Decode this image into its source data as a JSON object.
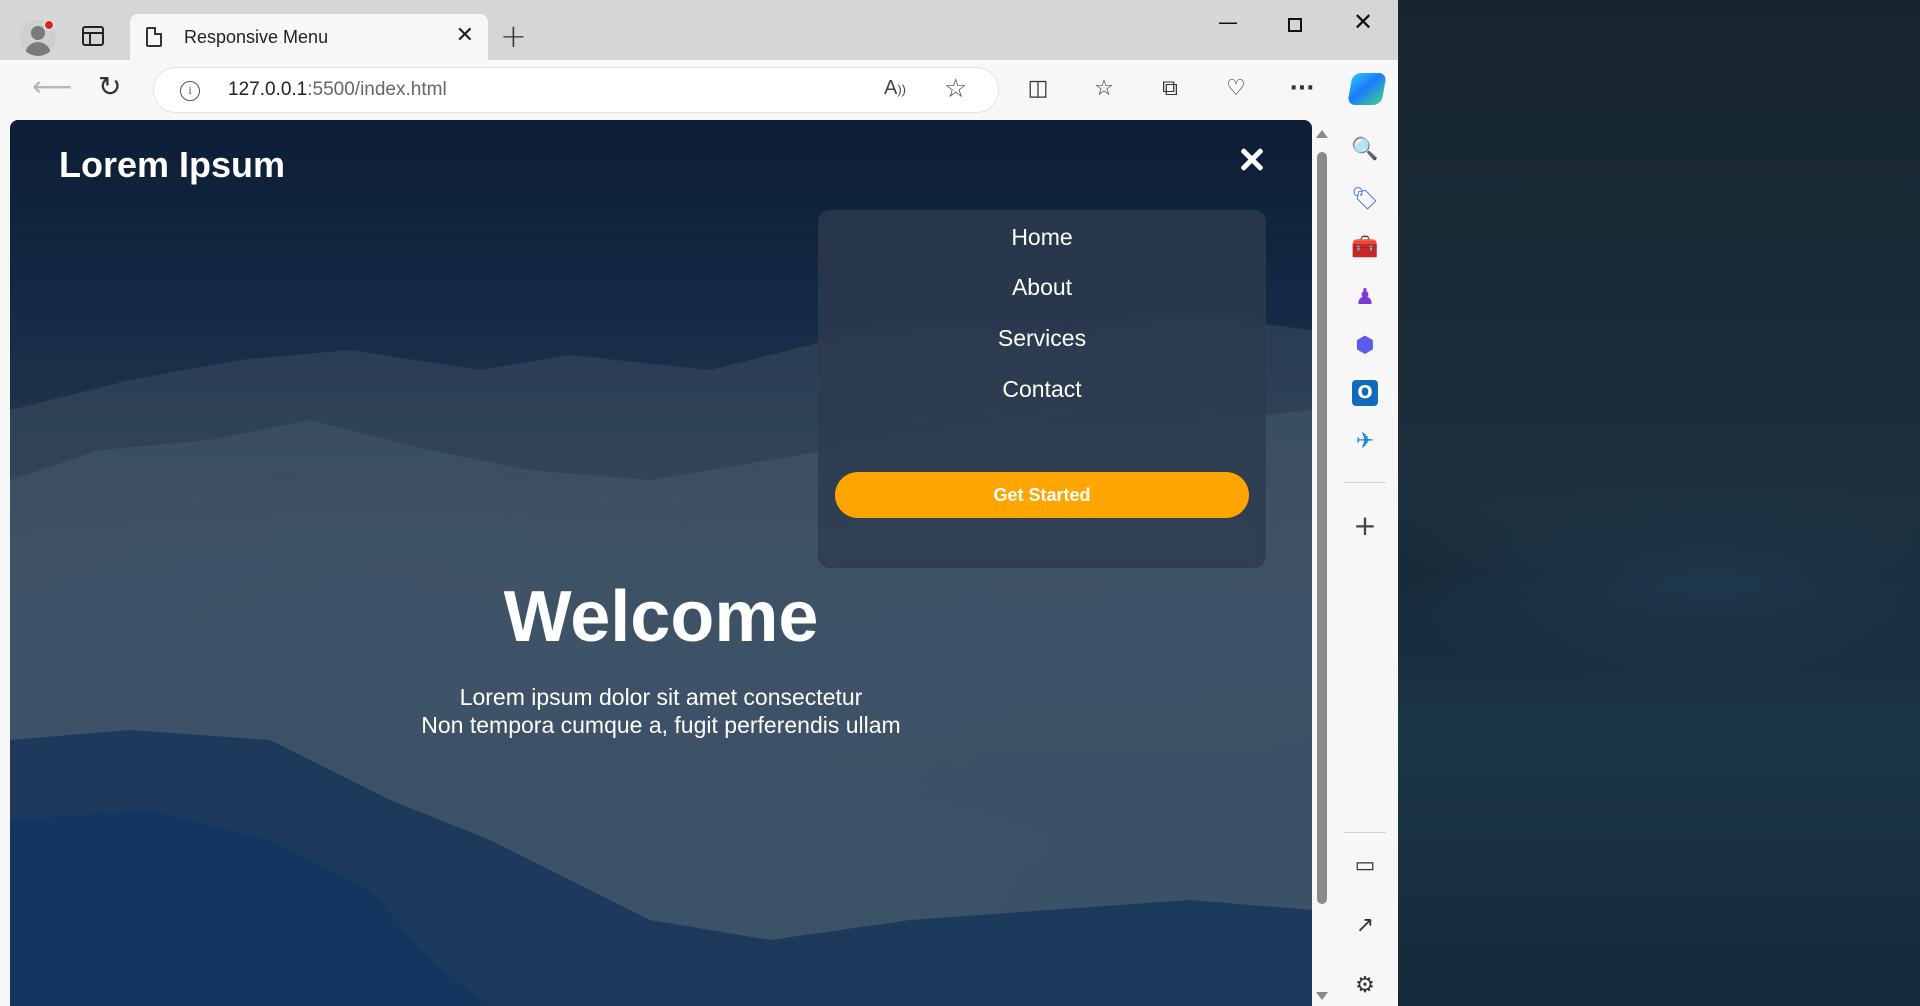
{
  "browser": {
    "tab_title": "Responsive Menu",
    "tab_close": "✕",
    "new_tab": "+",
    "window_controls": {
      "minimize": "—",
      "close": "✕"
    },
    "url_host": "127.0.0.1",
    "url_rest": ":5500/index.html",
    "read_aloud": "A",
    "favorite_glyph": "☆",
    "toolbar_icons": [
      "split-screen-icon",
      "favorites-icon",
      "collections-icon",
      "browser-essentials-icon",
      "more-icon"
    ],
    "more_glyph": "···"
  },
  "sidebar": {
    "items": [
      {
        "name": "search-icon",
        "glyph": "🔍"
      },
      {
        "name": "shopping-tag-icon",
        "glyph": "🏷"
      },
      {
        "name": "tools-icon",
        "glyph": "🧰"
      },
      {
        "name": "games-icon",
        "glyph": "♟"
      },
      {
        "name": "microsoft365-icon",
        "glyph": "⬢"
      },
      {
        "name": "outlook-icon",
        "glyph": "O"
      },
      {
        "name": "drop-icon",
        "glyph": "✈"
      }
    ],
    "add_glyph": "+",
    "bottom": [
      {
        "name": "hide-sidebar-icon",
        "glyph": "▭"
      },
      {
        "name": "open-external-icon",
        "glyph": "↗"
      },
      {
        "name": "settings-icon",
        "glyph": "⚙"
      }
    ]
  },
  "page": {
    "logo": "Lorem Ipsum",
    "menu": {
      "items": [
        "Home",
        "About",
        "Services",
        "Contact"
      ],
      "cta": "Get Started"
    },
    "hero": {
      "title": "Welcome",
      "line1": "Lorem ipsum dolor sit amet consectetur",
      "line2": "Non tempora cumque a, fugit perferendis ullam"
    }
  },
  "colors": {
    "cta_background": "#ffa500",
    "menu_background": "#2d3a4e"
  }
}
